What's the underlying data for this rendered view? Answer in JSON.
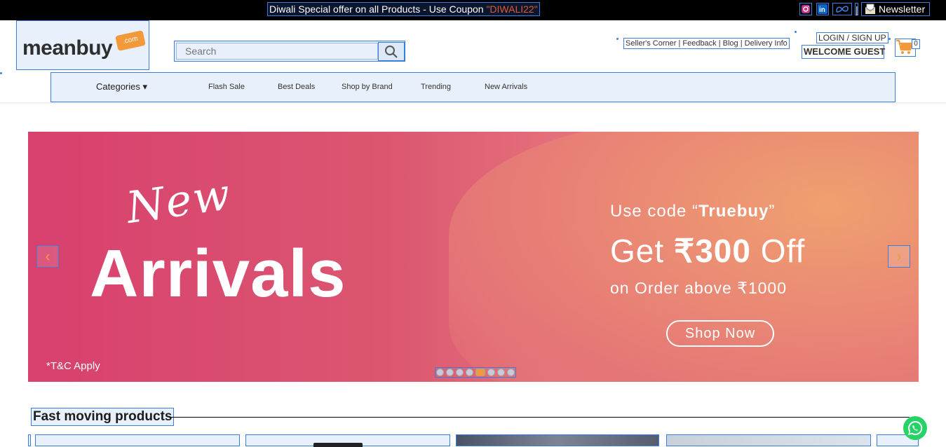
{
  "topbar": {
    "promo_prefix": "Diwali Special offer on all Products - Use Coupon ",
    "promo_coupon": "\"DIWALI22\"",
    "separator": "|",
    "newsletter_label": "Newsletter"
  },
  "header": {
    "logo_text": "meanbuy",
    "logo_tag": ".com",
    "search": {
      "placeholder": "Search"
    },
    "links": "Seller's Corner | Feedback | Blog | Delivery Info",
    "login": "LOGIN / SIGN UP",
    "welcome": "WELCOME GUEST",
    "cart_count": "0"
  },
  "nav": {
    "categories": "Categories ▾",
    "items": [
      "Flash Sale",
      "Best Deals",
      "Shop by Brand",
      "Trending",
      "New Arrivals"
    ]
  },
  "banner": {
    "script_word": "New",
    "headline": "Arrivals",
    "terms": "*T&C Apply",
    "code_prefix": "Use code “",
    "code": "Truebuy",
    "code_suffix": "”",
    "offer_prefix": "Get ",
    "offer_amount": "₹300",
    "offer_suffix": " Off",
    "condition": "on Order above ₹1000",
    "cta": "Shop Now",
    "prev_arrow": "‹",
    "next_arrow": "›",
    "slide_count": 8,
    "active_slide": 5
  },
  "section": {
    "title": "Fast moving products"
  },
  "colors": {
    "accent": "#3b7ddd",
    "brand_orange": "#f29a3a",
    "coupon": "#e05a2b",
    "whatsapp": "#25d366"
  }
}
